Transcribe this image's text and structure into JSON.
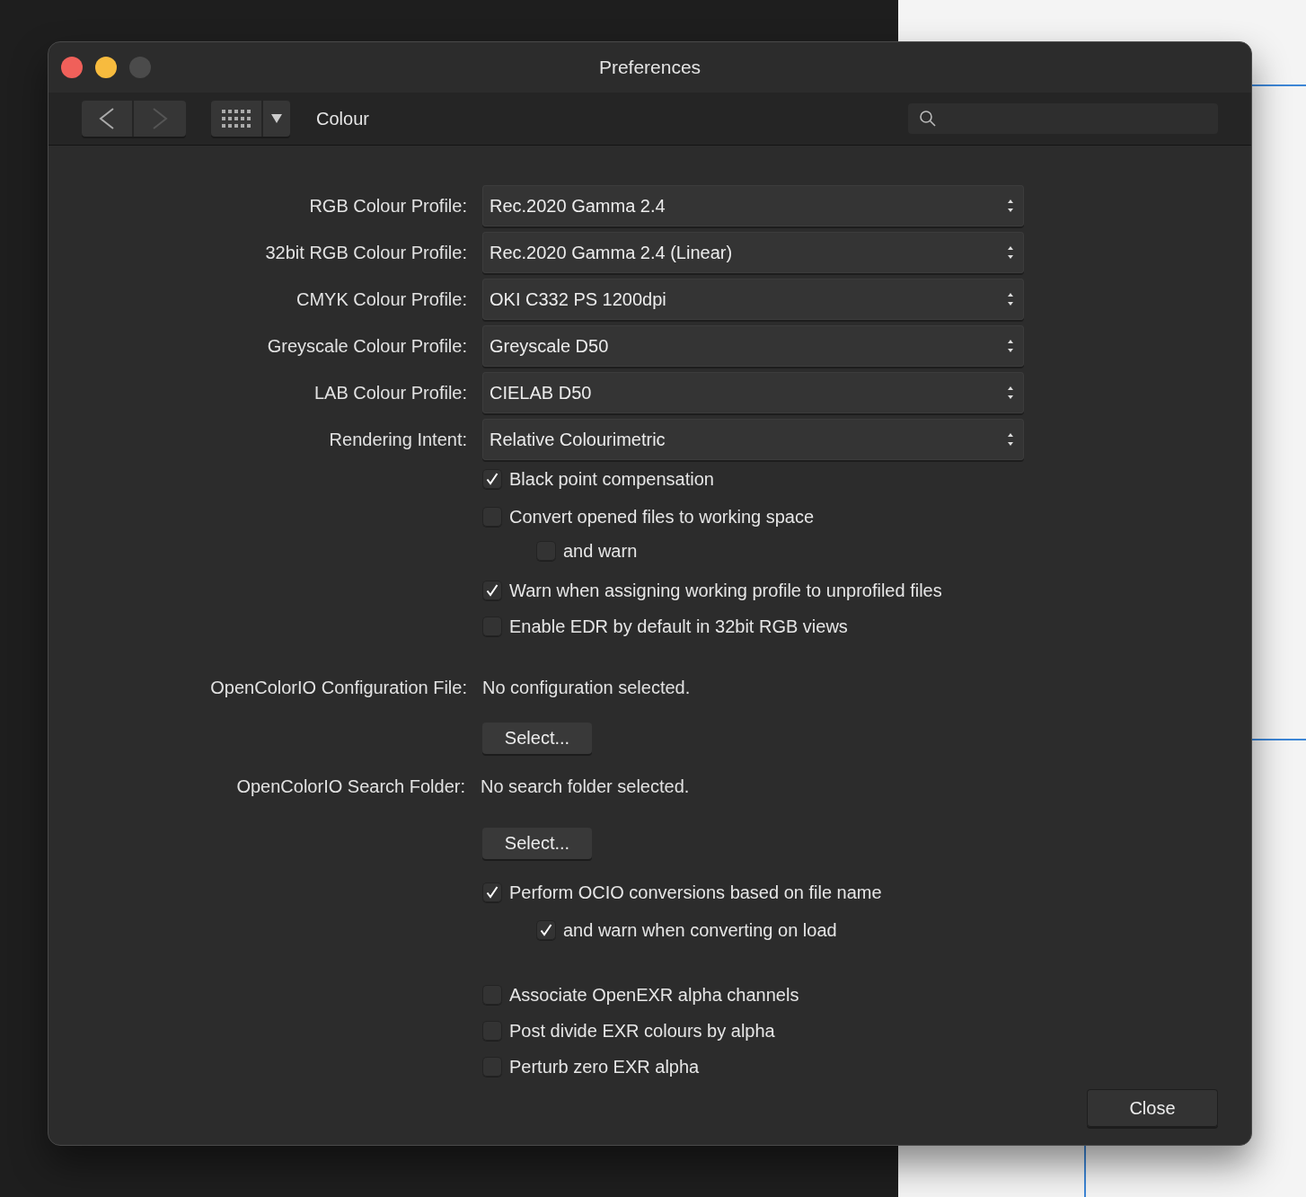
{
  "window": {
    "title": "Preferences"
  },
  "toolbar": {
    "section": "Colour"
  },
  "profiles": [
    {
      "label": "RGB Colour Profile:",
      "value": "Rec.2020 Gamma 2.4"
    },
    {
      "label": "32bit RGB Colour Profile:",
      "value": "Rec.2020 Gamma 2.4 (Linear)"
    },
    {
      "label": "CMYK Colour Profile:",
      "value": "OKI C332 PS 1200dpi"
    },
    {
      "label": "Greyscale Colour Profile:",
      "value": "Greyscale D50"
    },
    {
      "label": "LAB Colour Profile:",
      "value": "CIELAB D50"
    },
    {
      "label": "Rendering Intent:",
      "value": "Relative Colourimetric"
    }
  ],
  "colour_options": [
    {
      "label": "Black point compensation",
      "checked": true
    },
    {
      "label": "Convert opened files to working space",
      "checked": false,
      "children": [
        {
          "label": "and warn",
          "checked": false
        }
      ]
    },
    {
      "label": "Warn when assigning working profile to unprofiled files",
      "checked": true
    },
    {
      "label": "Enable EDR by default in 32bit RGB views",
      "checked": false
    }
  ],
  "ocio_config": {
    "label": "OpenColorIO Configuration File:",
    "value": "No configuration selected.",
    "button": "Select..."
  },
  "ocio_folder": {
    "label": "OpenColorIO Search Folder:",
    "value": "No search folder selected.",
    "button": "Select..."
  },
  "ocio_options": [
    {
      "label": "Perform OCIO conversions based on file name",
      "checked": true,
      "children": [
        {
          "label": "and warn when converting on load",
          "checked": true
        }
      ]
    }
  ],
  "exr_options": [
    {
      "label": "Associate OpenEXR alpha channels",
      "checked": false
    },
    {
      "label": "Post divide EXR colours by alpha",
      "checked": false
    },
    {
      "label": "Perturb zero EXR alpha",
      "checked": false
    }
  ],
  "close_button": "Close"
}
